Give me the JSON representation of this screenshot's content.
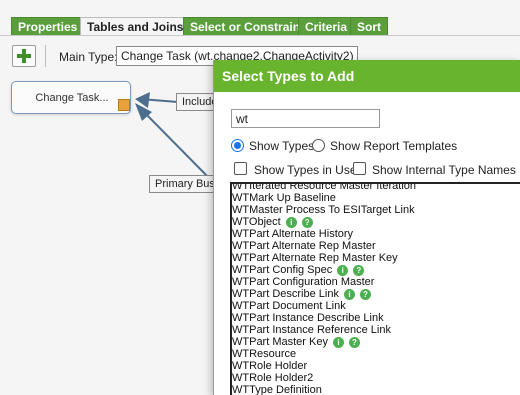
{
  "tabs": [
    "Properties",
    "Tables and Joins",
    "Select or Constrain",
    "Criteria",
    "Sort"
  ],
  "active_tab": 1,
  "toolbar": {
    "main_type_label": "Main Type:",
    "main_type_value": "Change Task (wt.change2.ChangeActivity2)"
  },
  "diagram": {
    "node_label": "Change Task...",
    "link_labels": [
      "Include",
      "Primary Bus"
    ]
  },
  "dialog": {
    "title": "Select Types to Add",
    "search_value": "wt",
    "show_types_label": "Show Types",
    "show_report_templates_label": "Show Report Templates",
    "show_types_in_use_label": "Show Types in Use",
    "show_internal_type_names_label": "Show Internal Type Names",
    "types": [
      {
        "name": "WTIterated Resource Master Iteration",
        "info": false
      },
      {
        "name": "WTMark Up Baseline",
        "info": false
      },
      {
        "name": "WTMaster Process To ESITarget Link",
        "info": false
      },
      {
        "name": "WTObject",
        "info": true
      },
      {
        "name": "WTPart Alternate History",
        "info": false
      },
      {
        "name": "WTPart Alternate Rep Master",
        "info": false
      },
      {
        "name": "WTPart Alternate Rep Master Key",
        "info": false
      },
      {
        "name": "WTPart Config Spec",
        "info": true
      },
      {
        "name": "WTPart Configuration Master",
        "info": false
      },
      {
        "name": "WTPart Describe Link",
        "info": true
      },
      {
        "name": "WTPart Document Link",
        "info": false
      },
      {
        "name": "WTPart Instance Describe Link",
        "info": false
      },
      {
        "name": "WTPart Instance Reference Link",
        "info": false
      },
      {
        "name": "WTPart Master Key",
        "info": true
      },
      {
        "name": "WTResource",
        "info": false
      },
      {
        "name": "WTRole Holder",
        "info": false
      },
      {
        "name": "WTRole Holder2",
        "info": false
      },
      {
        "name": "WTType Definition",
        "info": false
      }
    ],
    "badge_info": "i",
    "badge_help": "?"
  },
  "colors": {
    "tab_green": "#5a9f3c",
    "dialog_header_green": "#68b42f",
    "badge_green": "#4caf50",
    "radio_blue": "#1a73e8",
    "link_arrow": "#4d6e8e",
    "node_handle_orange": "#e9a23b"
  }
}
